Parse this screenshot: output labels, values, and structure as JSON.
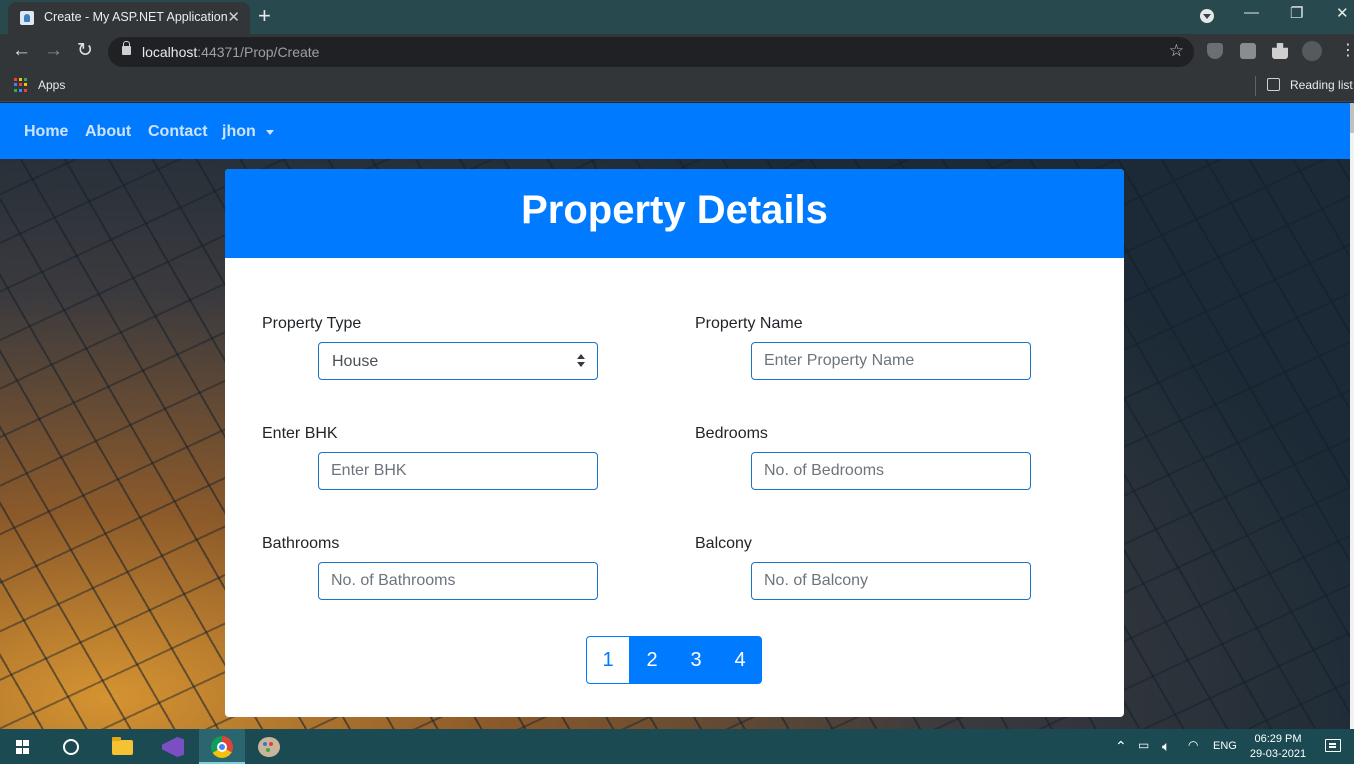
{
  "browser": {
    "tab_title": "Create - My ASP.NET Application",
    "tab_close": "✕",
    "new_tab": "+",
    "url_host": "localhost",
    "url_rest": ":44371/Prop/Create",
    "back": "←",
    "forward": "→",
    "reload": "↻",
    "star": "☆",
    "minimize": "—",
    "restore": "❐",
    "close": "✕",
    "bookmarks": {
      "apps_label": "Apps",
      "reading_list_label": "Reading list"
    }
  },
  "navbar": {
    "items": [
      "Home",
      "About",
      "Contact"
    ],
    "user": "jhon"
  },
  "card": {
    "title": "Property Details",
    "fields": {
      "property_type": {
        "label": "Property Type",
        "value": "House"
      },
      "property_name": {
        "label": "Property Name",
        "placeholder": "Enter Property Name"
      },
      "bhk": {
        "label": "Enter BHK",
        "placeholder": "Enter BHK"
      },
      "bedrooms": {
        "label": "Bedrooms",
        "placeholder": "No. of Bedrooms"
      },
      "bathrooms": {
        "label": "Bathrooms",
        "placeholder": "No. of Bathrooms"
      },
      "balcony": {
        "label": "Balcony",
        "placeholder": "No. of Balcony"
      }
    },
    "pagination": [
      "1",
      "2",
      "3",
      "4"
    ]
  },
  "taskbar": {
    "lang": "ENG",
    "time": "06:29 PM",
    "date": "29-03-2021"
  },
  "colors": {
    "primary": "#007bff",
    "taskbar": "#1b4a52",
    "tab_strip": "#284a4f"
  }
}
